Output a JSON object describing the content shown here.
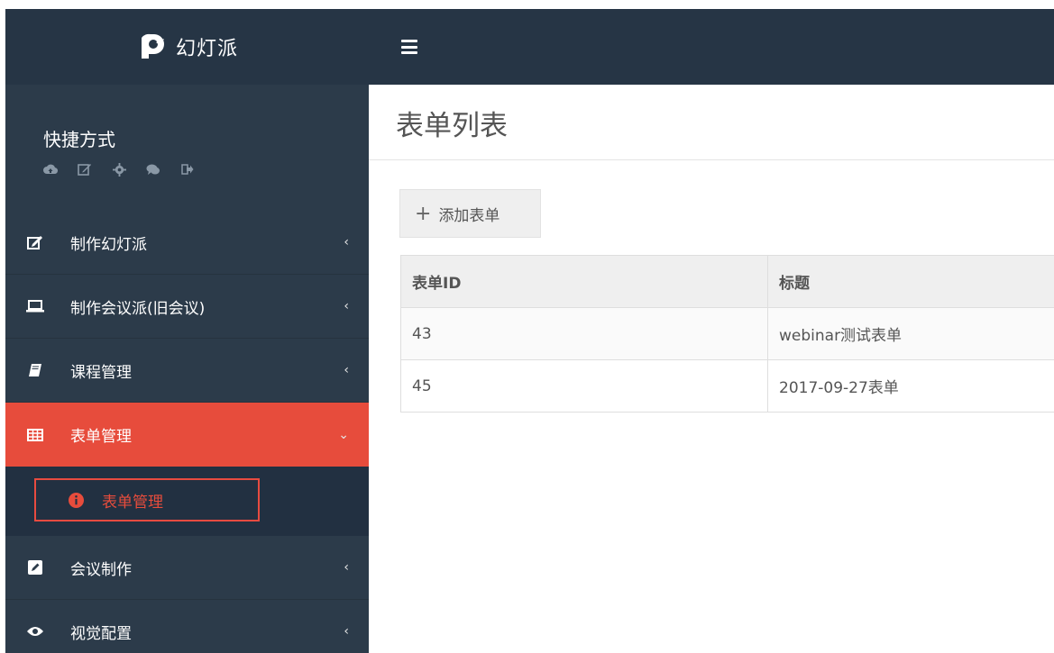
{
  "brand": {
    "name": "幻灯派"
  },
  "shortcut": {
    "title": "快捷方式",
    "icons": [
      "cloud-upload-icon",
      "edit-icon",
      "gear-icon",
      "comments-icon",
      "sign-out-icon"
    ]
  },
  "menu": {
    "items": [
      {
        "label": "制作幻灯派",
        "icon": "edit-icon"
      },
      {
        "label": "制作会议派(旧会议)",
        "icon": "laptop-icon"
      },
      {
        "label": "课程管理",
        "icon": "book-icon"
      },
      {
        "label": "表单管理",
        "icon": "table-icon"
      },
      {
        "label": "会议制作",
        "icon": "pencil-square-icon"
      },
      {
        "label": "视觉配置",
        "icon": "eye-icon"
      }
    ],
    "submenu": {
      "label": "表单管理",
      "icon": "info-circle-icon"
    }
  },
  "colors": {
    "sidebar": "#2c3b4a",
    "topbar": "#263545",
    "active": "#e74c3c"
  },
  "main": {
    "title": "表单列表",
    "add_button": "添加表单",
    "table": {
      "headers": [
        "表单ID",
        "标题"
      ],
      "rows": [
        [
          "43",
          "webinar测试表单"
        ],
        [
          "45",
          "2017-09-27表单"
        ]
      ]
    }
  }
}
